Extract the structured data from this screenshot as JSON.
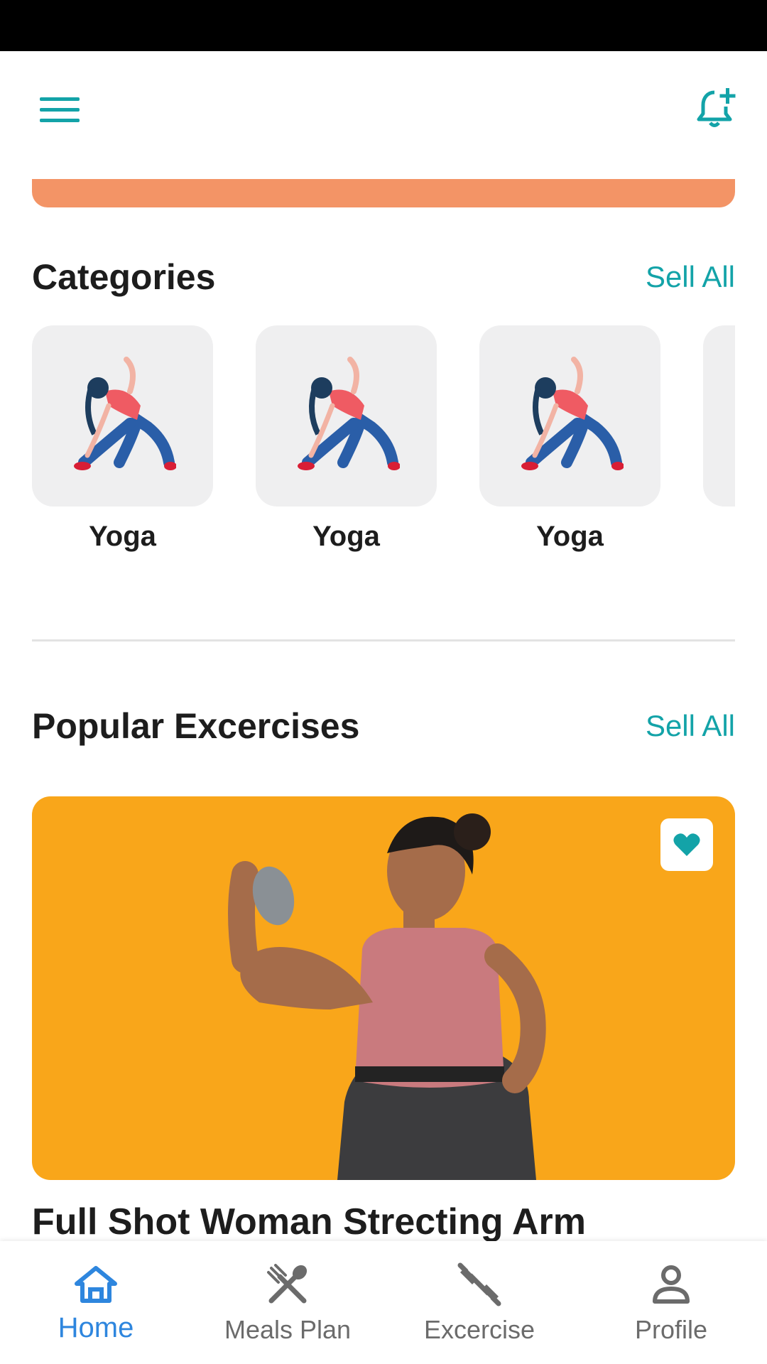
{
  "colors": {
    "accent": "#13a3a8",
    "banner": "#f39466",
    "card_bg": "#f9a61a",
    "active_nav": "#2e86de",
    "inactive_nav": "#6b6b6b"
  },
  "app_bar": {
    "menu_icon": "hamburger-menu-icon",
    "notification_icon": "bell-plus-icon"
  },
  "categories": {
    "title": "Categories",
    "see_all": "Sell All",
    "items": [
      {
        "label": "Yoga",
        "icon": "yoga-stretch-illustration"
      },
      {
        "label": "Yoga",
        "icon": "yoga-stretch-illustration"
      },
      {
        "label": "Yoga",
        "icon": "yoga-stretch-illustration"
      }
    ]
  },
  "popular": {
    "title": "Popular Excercises",
    "see_all": "Sell All",
    "card": {
      "title": "Full Shot Woman Strecting Arm",
      "favorite_icon": "heart-icon"
    }
  },
  "bottom_nav": {
    "items": [
      {
        "label": "Home",
        "icon": "home-icon",
        "active": true
      },
      {
        "label": "Meals Plan",
        "icon": "fork-spoon-icon",
        "active": false
      },
      {
        "label": "Excercise",
        "icon": "dumbbell-icon",
        "active": false
      },
      {
        "label": "Profile",
        "icon": "person-icon",
        "active": false
      }
    ]
  }
}
